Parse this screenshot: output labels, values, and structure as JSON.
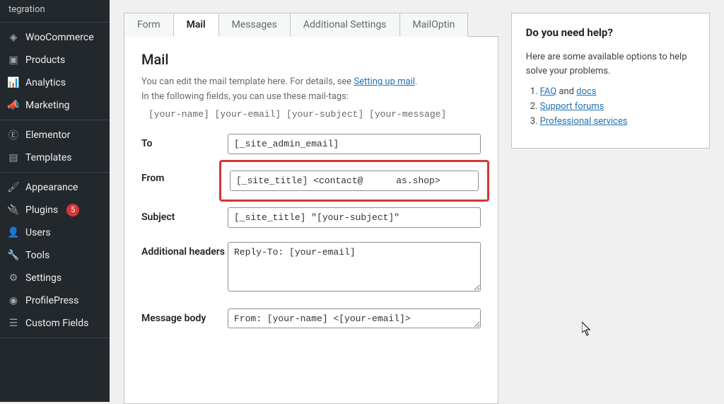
{
  "sidebar": {
    "top_label": "tegration",
    "items": [
      {
        "label": "WooCommerce",
        "icon": "◈"
      },
      {
        "label": "Products",
        "icon": "▣"
      },
      {
        "label": "Analytics",
        "icon": "📊"
      },
      {
        "label": "Marketing",
        "icon": "📣"
      },
      {
        "label": "Elementor",
        "icon": "Ⓔ"
      },
      {
        "label": "Templates",
        "icon": "▤"
      },
      {
        "label": "Appearance",
        "icon": "🖌"
      },
      {
        "label": "Plugins",
        "icon": "🔌",
        "badge": "5"
      },
      {
        "label": "Users",
        "icon": "👤"
      },
      {
        "label": "Tools",
        "icon": "🔧"
      },
      {
        "label": "Settings",
        "icon": "⚙"
      },
      {
        "label": "ProfilePress",
        "icon": "◉"
      },
      {
        "label": "Custom Fields",
        "icon": "☰"
      }
    ]
  },
  "tabs": [
    "Form",
    "Mail",
    "Messages",
    "Additional Settings",
    "MailOptin"
  ],
  "active_tab_index": 1,
  "mail": {
    "heading": "Mail",
    "help_line1a": "You can edit the mail template here. For details, see ",
    "help_link": "Setting up mail",
    "help_line1b": ".",
    "help_line2": "In the following fields, you can use these mail-tags:",
    "mail_tags": "[your-name] [your-email] [your-subject] [your-message]",
    "fields": {
      "to": {
        "label": "To",
        "value": "[_site_admin_email]"
      },
      "from": {
        "label": "From",
        "value": "[_site_title] <contact@      as.shop>"
      },
      "subject": {
        "label": "Subject",
        "value": "[_site_title] \"[your-subject]\""
      },
      "additional_headers": {
        "label": "Additional headers",
        "value": "Reply-To: [your-email]"
      },
      "message_body": {
        "label": "Message body",
        "value": "From: [your-name] <[your-email]>"
      }
    }
  },
  "help_box": {
    "title": "Do you need help?",
    "intro": "Here are some available options to help solve your problems.",
    "items": [
      {
        "prefix_link": "FAQ",
        "middle": " and ",
        "suffix_link": "docs"
      },
      {
        "prefix_link": "Support forums"
      },
      {
        "prefix_link": "Professional services"
      }
    ]
  }
}
